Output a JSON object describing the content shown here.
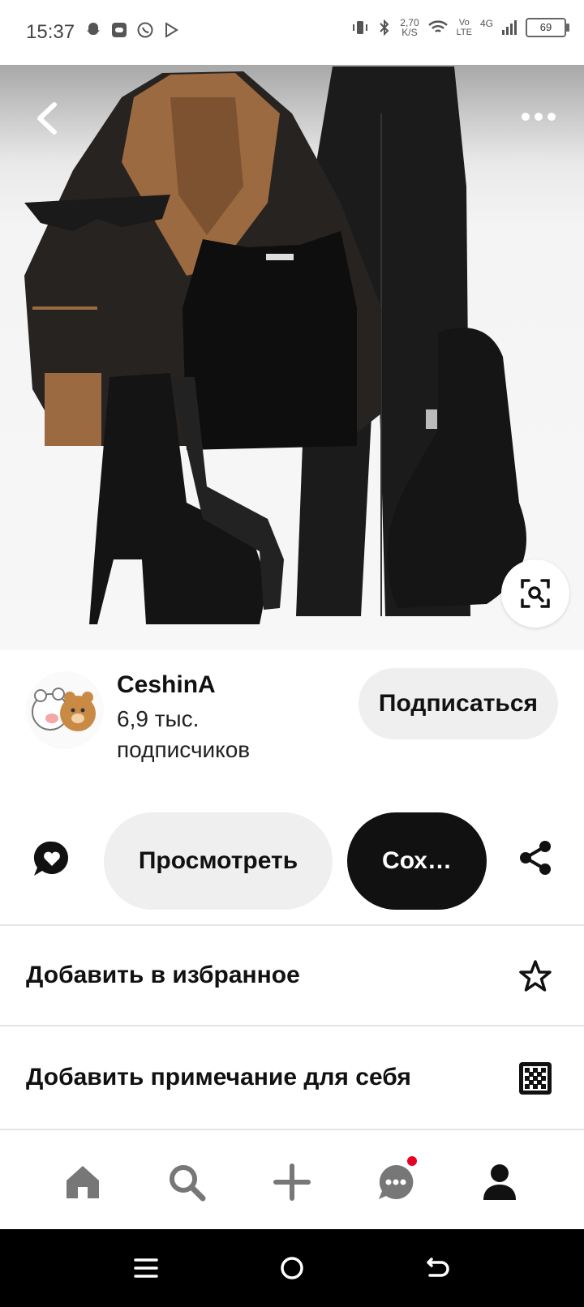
{
  "status_bar": {
    "time": "15:37",
    "net_speed_value": "2,70",
    "net_speed_unit": "K/S",
    "volte_top": "Vo",
    "volte_bottom": "LTE",
    "network": "4G",
    "battery": "69"
  },
  "pin": {
    "icons": [
      "back-arrow-icon",
      "more-dots-icon",
      "visual-search-icon"
    ]
  },
  "creator": {
    "name": "CeshinA",
    "subscribers": "6,9 тыс. подписчиков",
    "follow_label": "Подписаться"
  },
  "actions": {
    "view_label": "Просмотреть",
    "save_label": "Сох…"
  },
  "menu": [
    {
      "label": "Добавить в избранное",
      "icon": "star-icon"
    },
    {
      "label": "Добавить примечание для себя",
      "icon": "note-pattern-icon"
    }
  ],
  "bottom_nav": {
    "items": [
      "home-icon",
      "search-icon",
      "create-plus-icon",
      "messages-icon",
      "profile-icon"
    ],
    "notification_color": "#e60023"
  },
  "colors": {
    "primary_button": "#111111",
    "secondary_button": "#efefef",
    "accent": "#e60023"
  }
}
